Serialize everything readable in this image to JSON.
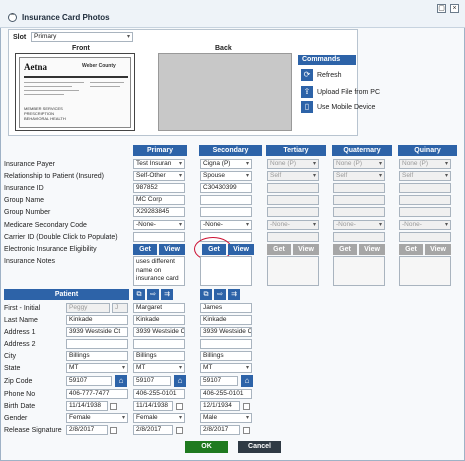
{
  "window": {
    "title": "Insurance Card Photos"
  },
  "slot": {
    "label": "Slot",
    "value": "Primary"
  },
  "card": {
    "front_label": "Front",
    "back_label": "Back",
    "brand": "Aetna",
    "right_logo": "Weber County",
    "lines": [
      "MEMBER SERVICES",
      "PRESCRIPTION",
      "BEHAVIORAL HEALTH"
    ]
  },
  "commands": {
    "title": "Commands",
    "items": [
      {
        "label": "Refresh",
        "icon": "refresh-icon"
      },
      {
        "label": "Upload File from PC",
        "icon": "upload-icon"
      },
      {
        "label": "Use Mobile Device",
        "icon": "mobile-icon"
      }
    ]
  },
  "rows": [
    "Insurance Payer",
    "Relationship to Patient (Insured)",
    "Insurance ID",
    "Group Name",
    "Group Number",
    "Medicare Secondary Code",
    "Carrier ID (Double Click to Populate)",
    "Electronic Insurance Eligibility",
    "Insurance Notes"
  ],
  "columns": [
    {
      "name": "Primary",
      "payer": "Test Insuran",
      "relationship": "Self-Other",
      "id": "987852",
      "group_name": "MC Corp",
      "group_number": "X29283845",
      "msc": "-None-",
      "notes": "uses different name on insurance card",
      "enabled": true
    },
    {
      "name": "Secondary",
      "payer": "Cigna (P)",
      "relationship": "Spouse",
      "id": "C30430399",
      "group_name": "",
      "group_number": "",
      "msc": "-None-",
      "notes": "",
      "enabled": true
    },
    {
      "name": "Tertiary",
      "payer": "None (P)",
      "relationship": "Self",
      "id": "",
      "group_name": "",
      "group_number": "",
      "msc": "-None-",
      "notes": "",
      "enabled": false
    },
    {
      "name": "Quaternary",
      "payer": "None (P)",
      "relationship": "Self",
      "id": "",
      "group_name": "",
      "group_number": "",
      "msc": "-None-",
      "notes": "",
      "enabled": false
    },
    {
      "name": "Quinary",
      "payer": "None (P)",
      "relationship": "Self",
      "id": "",
      "group_name": "",
      "group_number": "",
      "msc": "-None-",
      "notes": "",
      "enabled": false
    }
  ],
  "buttons": {
    "get": "Get",
    "view": "View",
    "ok": "OK",
    "cancel": "Cancel"
  },
  "patient": {
    "header": "Patient",
    "labels": [
      "First - Initial",
      "Last Name",
      "Address 1",
      "Address 2",
      "City",
      "State",
      "Zip Code",
      "Phone No",
      "Birth Date",
      "Gender",
      "Release Signature"
    ],
    "values": {
      "first": "Peggy",
      "initial": "J",
      "last": "Kinkade",
      "address1": "3939 Westside Ct",
      "address2": "",
      "city": "Billings",
      "state": "MT",
      "zip": "59107",
      "phone": "406-777-7477",
      "birth": "11/14/1938",
      "gender": "Female",
      "release": "2/8/2017"
    }
  },
  "insured": [
    {
      "first": "Margaret",
      "last": "Kinkade",
      "address1": "3939 Westside Ct",
      "address2": "",
      "city": "Billings",
      "state": "MT",
      "zip": "59107",
      "phone": "406-255-0101",
      "birth": "11/14/1938",
      "gender": "Female",
      "release": "2/8/2017"
    },
    {
      "first": "James",
      "last": "Kinkade",
      "address1": "3939 Westside Ct",
      "address2": "",
      "city": "Billings",
      "state": "MT",
      "zip": "59107",
      "phone": "406-255-0101",
      "birth": "12/1/1934",
      "gender": "Male",
      "release": "2/8/2017"
    }
  ],
  "colors": {
    "accent": "#2d63a8",
    "ok": "#1f7a1f",
    "cancel": "#2f3a44",
    "highlight": "#cc1133"
  }
}
